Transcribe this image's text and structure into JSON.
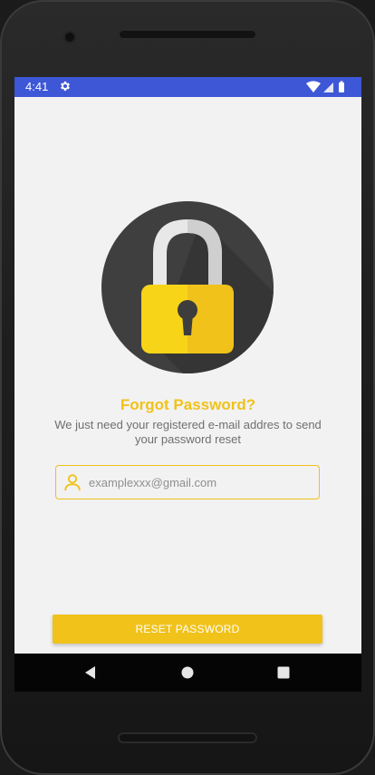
{
  "status_bar": {
    "time": "4:41",
    "icons": [
      "settings-icon",
      "wifi-icon",
      "signal-icon",
      "battery-icon"
    ],
    "color": "#3d57d6"
  },
  "lock_illustration": {
    "icon": "padlock-icon",
    "colors": {
      "circle": "#3f3f3f",
      "shackle": "#e8e8e8",
      "body": "#f7d418",
      "body_shade": "#f0c21a",
      "keyhole": "#3d3d3d"
    }
  },
  "title": "Forgot Password?",
  "subtitle": "We just need your registered e-mail addres to send your password reset",
  "email": {
    "icon": "user-icon",
    "value": "",
    "placeholder": "examplexxx@gmail.com"
  },
  "reset_button": {
    "label": "RESET PASSWORD"
  },
  "nav_bar": {
    "buttons": [
      "back-icon",
      "home-icon",
      "recents-icon"
    ]
  },
  "accent_color": "#f0c21a"
}
